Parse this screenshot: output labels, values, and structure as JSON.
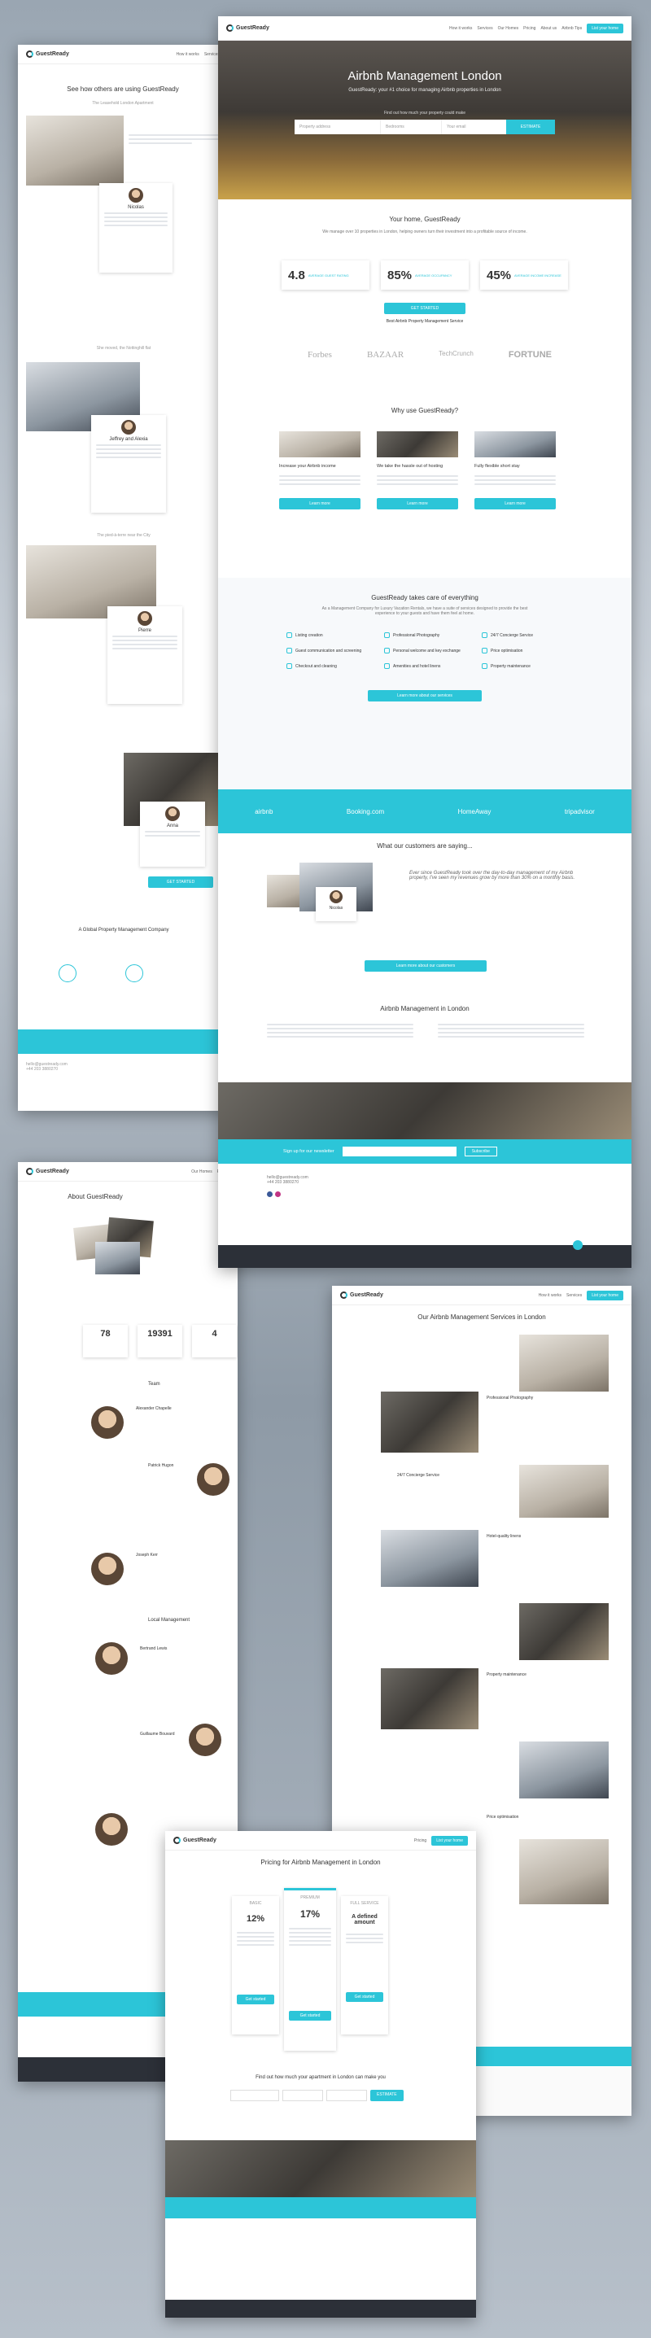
{
  "home": {
    "logo": "GuestReady",
    "nav": [
      "How it works",
      "Services",
      "Our Homes",
      "Pricing",
      "About us",
      "Airbnb Tips"
    ],
    "nav_cta": "List your home",
    "hero_title": "Airbnb Management London",
    "hero_subtitle": "GuestReady: your #1 choice for managing Airbnb properties in London",
    "search_label": "Find out how much your property could make",
    "search_fields": [
      "Property address",
      "Bedrooms",
      "Your email"
    ],
    "search_button": "ESTIMATE",
    "section_title": "Your home, GuestReady",
    "section_sub": "We manage over 10 properties in London, helping owners turn their investment into a profitable source of income.",
    "stats": [
      {
        "value": "4.8",
        "label": "AVERAGE GUEST RATING"
      },
      {
        "value": "85%",
        "label": "AVERAGE OCCUPANCY"
      },
      {
        "value": "45%",
        "label": "AVERAGE INCOME INCREASE"
      }
    ],
    "get_started": "GET STARTED",
    "rated": "Best Airbnb Property Management Service",
    "press": [
      "Forbes",
      "BAZAAR",
      "TechCrunch",
      "FORTUNE"
    ],
    "why_title": "Why use GuestReady?",
    "why_items": [
      {
        "title": "Increase your Airbnb income",
        "button": "Learn more"
      },
      {
        "title": "We take the hassle out of hosting",
        "button": "Learn more"
      },
      {
        "title": "Fully flexible short stay",
        "button": "Learn more"
      }
    ],
    "care_title": "GuestReady takes care of everything",
    "care_sub": "As a Management Company for Luxury Vacation Rentals, we have a suite of services designed to provide the best experience to your guests and have them feel at home.",
    "features": [
      "Listing creation",
      "Professional Photography",
      "24/7 Concierge Service",
      "Guest communication and screening",
      "Personal welcome and key exchange",
      "Price optimisation",
      "Checkout and cleaning",
      "Amenities and hotel linens",
      "Property maintenance"
    ],
    "care_link": "Learn more about our services",
    "partners": [
      "airbnb",
      "Booking.com",
      "HomeAway",
      "tripadvisor"
    ],
    "customers_title": "What our customers are saying...",
    "testimonial": "Ever since GuestReady took over the day-to-day management of my Airbnb property, I've seen my revenues grow by more than 30% on a monthly basis.",
    "testimonial_name": "Nicolas",
    "testimonial_button": "Learn more about our customers",
    "mgmt_title": "Airbnb Management in London",
    "newsletter_label": "Sign up for our newsletter",
    "newsletter_button": "Subscribe",
    "contact": [
      "hello@guestready.com",
      "+44 203 3880270"
    ]
  },
  "testimonials_page": {
    "title": "See how others are using GuestReady",
    "people": [
      "Nicolas",
      "Jeffrey and Alexia",
      "Pierre",
      "Anna"
    ],
    "section_labels": [
      "The Leasehold London Apartment",
      "She moved, the Nottinghill flat",
      "The pied-à-terre near the City"
    ],
    "global_title": "A Global Property Management Company",
    "cta": "GET STARTED"
  },
  "about_page": {
    "title": "About GuestReady",
    "stats": [
      {
        "value": "78"
      },
      {
        "value": "19391"
      },
      {
        "value": "4"
      }
    ],
    "team_title": "Team",
    "local_title": "Local Management",
    "people": [
      "Alexander Chapelle",
      "Patrick Hugon",
      "Joseph Kerr",
      "Bertrand Lewis",
      "Guillaume Bouvard"
    ]
  },
  "services_page": {
    "title": "Our Airbnb Management Services in London",
    "items": [
      "Professional Photography",
      "24/7 Concierge Service",
      "Hotel-quality linens",
      "Property maintenance",
      "Price optimisation"
    ]
  },
  "pricing_page": {
    "title": "Pricing for Airbnb Management in London",
    "plans": [
      {
        "name": "BASIC",
        "price": "12%",
        "button": "Get started"
      },
      {
        "name": "PREMIUM",
        "price": "17%",
        "button": "Get started"
      },
      {
        "name": "FULL SERVICE",
        "price": "A defined amount",
        "button": "Get started"
      }
    ],
    "estimate_title": "Find out how much your apartment in London can make you",
    "estimate_button": "ESTIMATE"
  },
  "colors": {
    "accent": "#2cc5d8",
    "dark": "#2c3038"
  }
}
